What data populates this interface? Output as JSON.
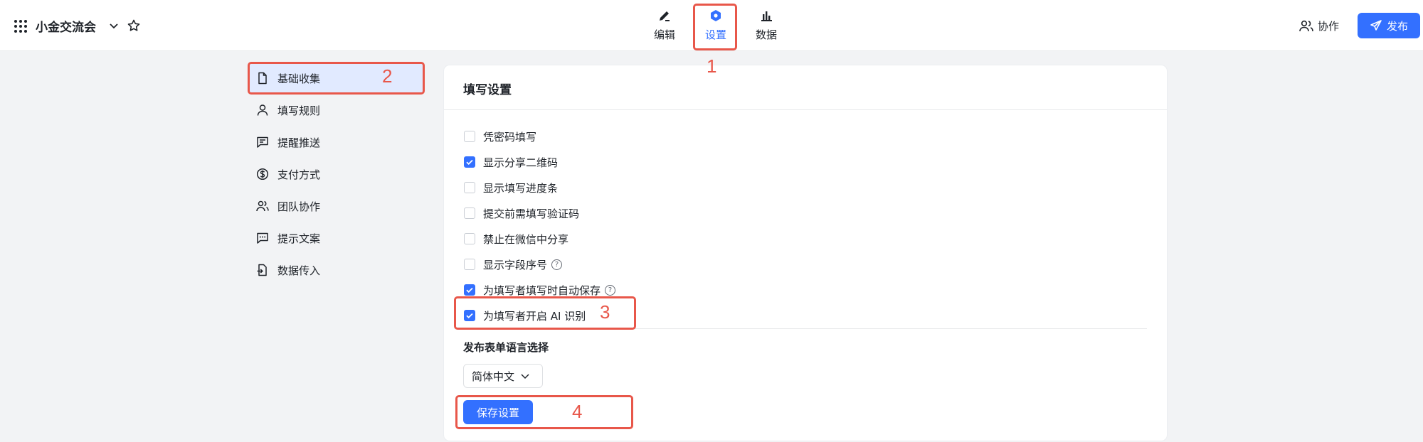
{
  "header": {
    "app_title": "小金交流会",
    "tabs": [
      {
        "label": "编辑",
        "icon": "pen-icon",
        "active": false
      },
      {
        "label": "设置",
        "icon": "hexagon-gear-icon",
        "active": true
      },
      {
        "label": "数据",
        "icon": "bar-chart-icon",
        "active": false
      }
    ],
    "collab_label": "协作",
    "publish_label": "发布"
  },
  "sidebar": {
    "items": [
      {
        "label": "基础收集",
        "icon": "document-icon",
        "active": true
      },
      {
        "label": "填写规则",
        "icon": "user-icon"
      },
      {
        "label": "提醒推送",
        "icon": "message-icon"
      },
      {
        "label": "支付方式",
        "icon": "dollar-icon"
      },
      {
        "label": "团队协作",
        "icon": "users-icon"
      },
      {
        "label": "提示文案",
        "icon": "comment-icon"
      },
      {
        "label": "数据传入",
        "icon": "import-icon"
      }
    ]
  },
  "panel": {
    "title": "填写设置",
    "options": [
      {
        "label": "凭密码填写",
        "checked": false,
        "help": false
      },
      {
        "label": "显示分享二维码",
        "checked": true,
        "help": false
      },
      {
        "label": "显示填写进度条",
        "checked": false,
        "help": false
      },
      {
        "label": "提交前需填写验证码",
        "checked": false,
        "help": false
      },
      {
        "label": "禁止在微信中分享",
        "checked": false,
        "help": false
      },
      {
        "label": "显示字段序号",
        "checked": false,
        "help": true
      },
      {
        "label": "为填写者填写时自动保存",
        "checked": true,
        "help": true
      },
      {
        "label": "为填写者开启 AI 识别",
        "checked": true,
        "help": false
      }
    ],
    "language_title": "发布表单语言选择",
    "language_value": "简体中文",
    "save_label": "保存设置"
  },
  "annotations": {
    "n1": "1",
    "n2": "2",
    "n3": "3",
    "n4": "4"
  },
  "colors": {
    "accent": "#3370ff",
    "highlight": "#e8574a"
  }
}
